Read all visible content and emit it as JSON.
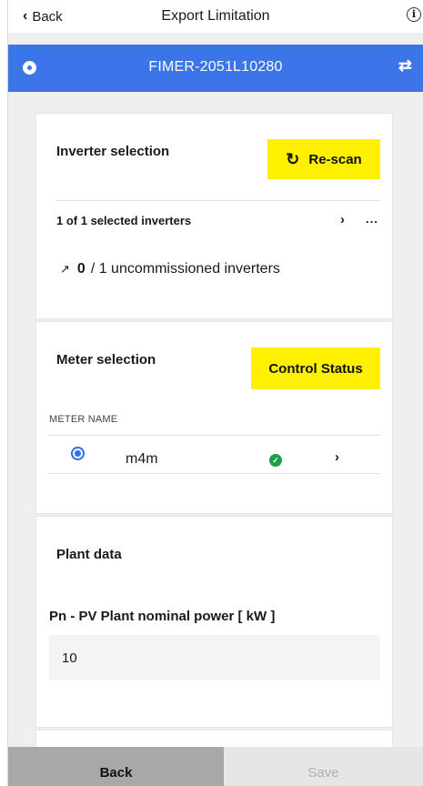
{
  "nav": {
    "back_label": "Back",
    "title": "Export Limitation",
    "info_icon": "info-circle-icon"
  },
  "device": {
    "name": "FIMER-2051L10280",
    "status_icon": "radio-dot-icon",
    "swap_icon": "swap-arrows-icon"
  },
  "inverter_selection": {
    "title": "Inverter selection",
    "rescan_label": "Re-scan",
    "selected_text": "1 of 1 selected inverters",
    "more_label": "...",
    "uncommissioned_count": "0",
    "uncommissioned_rest": "/ 1 uncommissioned inverters"
  },
  "meter_selection": {
    "title": "Meter selection",
    "control_status_label": "Control Status",
    "column_header": "METER NAME",
    "meters": [
      {
        "name": "m4m",
        "selected": true,
        "status": "ok"
      }
    ]
  },
  "plant_data": {
    "title": "Plant data",
    "field_label": "Pn - PV Plant nominal power [ kW ]",
    "field_value": "10"
  },
  "footer": {
    "back_label": "Back",
    "save_label": "Save"
  },
  "colors": {
    "accent_blue": "#3b75e8",
    "highlight_yellow": "#fff000",
    "ok_green": "#1f9e4c"
  }
}
